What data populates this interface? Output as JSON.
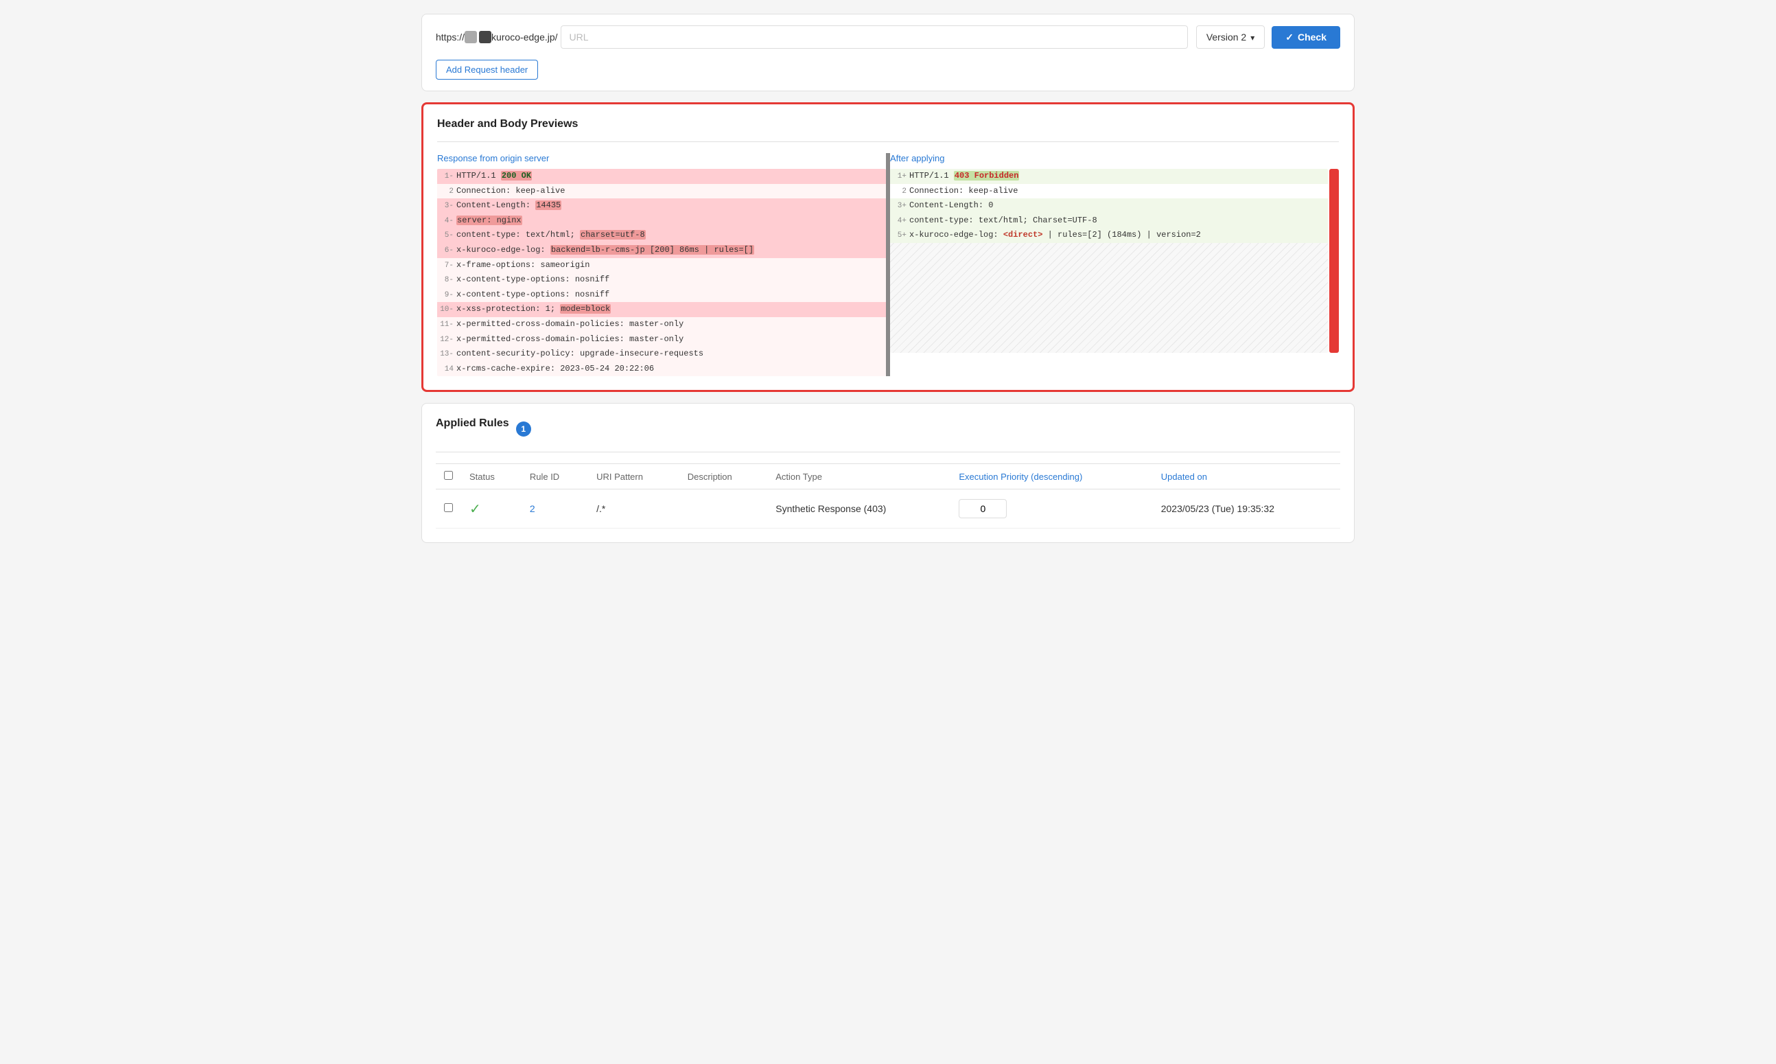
{
  "url_bar": {
    "protocol": "https://",
    "squares": [
      "gray",
      "dark"
    ],
    "domain": "kuroco-edge.jp/",
    "input_placeholder": "URL",
    "version_label": "Version 2",
    "check_label": "Check"
  },
  "add_header": {
    "label": "Add Request header"
  },
  "preview_section": {
    "title": "Header and Body Previews",
    "left_label": "Response from origin server",
    "right_label": "After applying",
    "left_lines": [
      {
        "num": "1-",
        "text": "HTTP/1.1 ",
        "status": "200 OK",
        "highlight": true
      },
      {
        "num": "2",
        "text": "Connection: keep-alive",
        "highlight": false
      },
      {
        "num": "3-",
        "text": "Content-Length: ",
        "hl_text": "14435",
        "highlight": true
      },
      {
        "num": "4-",
        "text": "",
        "hl_text": "server: nginx",
        "highlight": true
      },
      {
        "num": "5-",
        "text": "content-type: text/html; ",
        "hl_text": "charset=utf-8",
        "highlight": true
      },
      {
        "num": "6-",
        "text": "x-kuroco-edge-log: ",
        "hl_text": "backend=lb-r-cms-jp [200] 86ms | rules=[]",
        "highlight": true
      },
      {
        "num": "7-",
        "text": "x-frame-options: sameorigin",
        "highlight": false
      },
      {
        "num": "8-",
        "text": "x-content-type-options: nosniff",
        "highlight": false
      },
      {
        "num": "9-",
        "text": "x-content-type-options: nosniff",
        "highlight": false
      },
      {
        "num": "10-",
        "text": "x-xss-protection: 1; ",
        "hl_text": "mode=block",
        "highlight": true
      },
      {
        "num": "11-",
        "text": "x-permitted-cross-domain-policies: master-only",
        "highlight": false
      },
      {
        "num": "12-",
        "text": "x-permitted-cross-domain-policies: master-only",
        "highlight": false
      },
      {
        "num": "13-",
        "text": "content-security-policy: upgrade-insecure-requests",
        "highlight": false
      },
      {
        "num": "14",
        "text": "x-rcms-cache-expire: 2023-05-24 20:22:06",
        "highlight": false
      }
    ],
    "right_lines": [
      {
        "num": "1+",
        "text": "HTTP/1.1 ",
        "status": "403 Forbidden",
        "highlight": true
      },
      {
        "num": "2",
        "text": "Connection: keep-alive",
        "highlight": false
      },
      {
        "num": "3+",
        "text": "Content-Length: 0",
        "highlight": true
      },
      {
        "num": "4+",
        "text": "content-type: text/html; Charset=UTF-8",
        "highlight": true
      },
      {
        "num": "5+",
        "text": "x-kuroco-edge-log: ",
        "direct_tag": "<direct>",
        "rest": " | rules=[2] (184ms) | version=2",
        "highlight": true
      }
    ]
  },
  "applied_rules": {
    "title": "Applied Rules",
    "badge_count": "1",
    "columns": [
      {
        "label": "Status",
        "sortable": false
      },
      {
        "label": "Rule ID",
        "sortable": false
      },
      {
        "label": "URI Pattern",
        "sortable": false
      },
      {
        "label": "Description",
        "sortable": false
      },
      {
        "label": "Action Type",
        "sortable": false
      },
      {
        "label": "Execution Priority (descending)",
        "sortable": true
      },
      {
        "label": "Updated on",
        "sortable": true
      }
    ],
    "rows": [
      {
        "status_icon": "✓",
        "rule_id": "2",
        "uri_pattern": "/.*",
        "description": "",
        "action_type": "Synthetic Response (403)",
        "priority": "0",
        "updated_on": "2023/05/23 (Tue) 19:35:32"
      }
    ]
  }
}
